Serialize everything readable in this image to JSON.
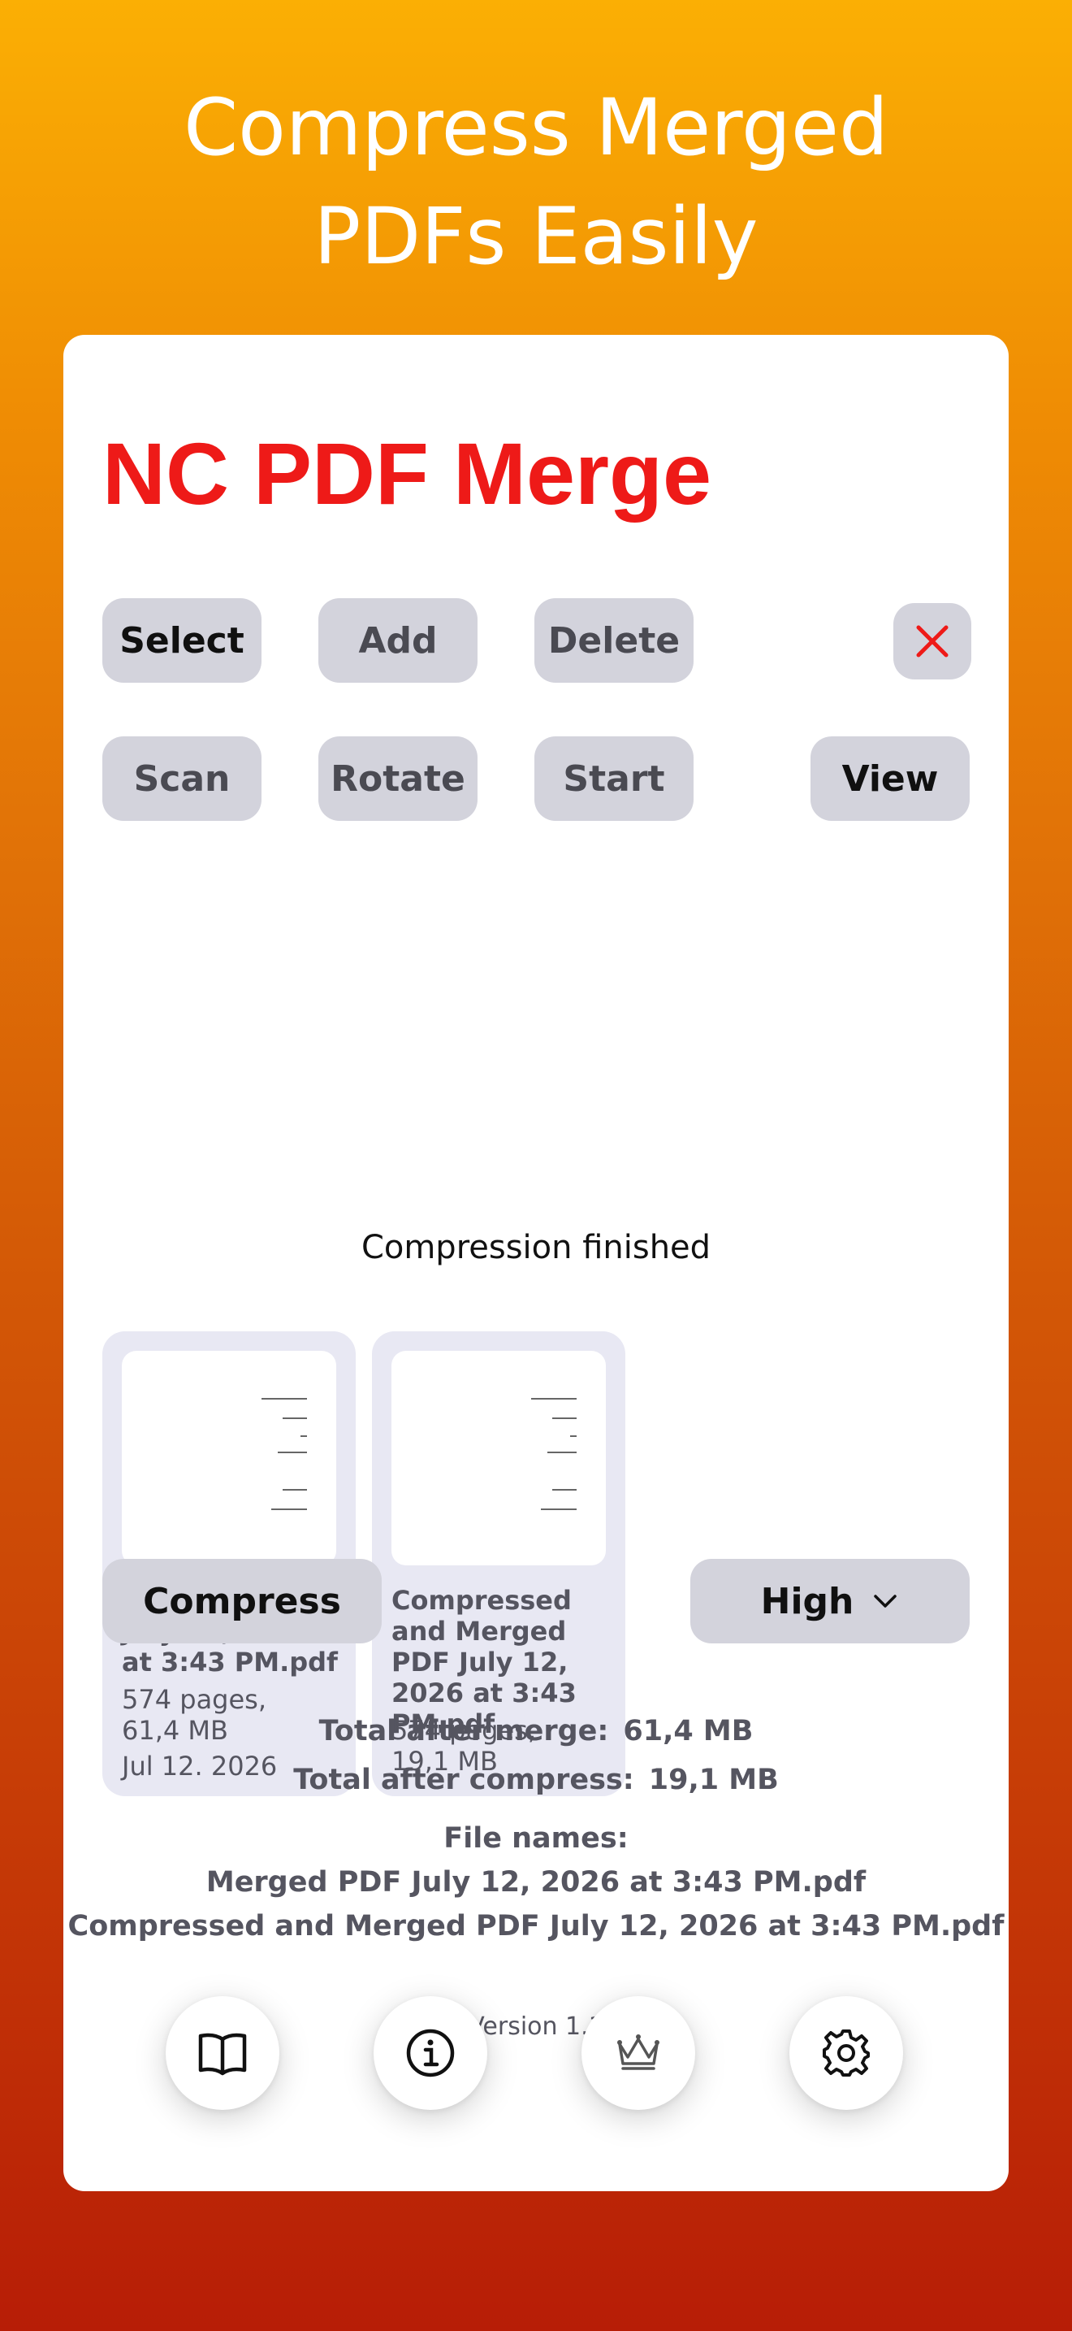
{
  "headline": {
    "line1": "Compress Merged",
    "line2": "PDFs Easily"
  },
  "app": {
    "title": "NC PDF Merge"
  },
  "toolbar": {
    "select": "Select",
    "add": "Add",
    "delete": "Delete",
    "close_icon": "close-icon",
    "scan": "Scan",
    "rotate": "Rotate",
    "start": "Start",
    "view": "View"
  },
  "status": "Compression finished",
  "files": [
    {
      "name": "Merged PDF July 12, 2026 at 3:43 PM.pdf",
      "pages": "574 pages,",
      "size": "61,4 MB",
      "date": "Jul 12. 2026"
    },
    {
      "name": "Compressed and Merged PDF July 12, 2026 at 3:43 PM.pdf",
      "pages": "574 pages,",
      "size": "19,1 MB"
    }
  ],
  "compress": {
    "button": "Compress",
    "level": "High"
  },
  "totals": {
    "merge_label": "Total after merge:",
    "merge_value": "61,4 MB",
    "compress_label": "Total after compress:",
    "compress_value": "19,1 MB",
    "file_names_label": "File names:",
    "file_name_1": "Merged PDF July 12, 2026 at 3:43 PM.pdf",
    "file_name_2": "Compressed and Merged PDF July 12, 2026 at 3:43 PM.pdf"
  },
  "version": "Version 1.1",
  "bottom_icons": [
    "book-icon",
    "info-icon",
    "crown-icon",
    "gear-icon"
  ],
  "colors": {
    "accent_red": "#ee1a18",
    "button_gray": "#d3d3dc",
    "file_card": "#e8e8f3"
  }
}
